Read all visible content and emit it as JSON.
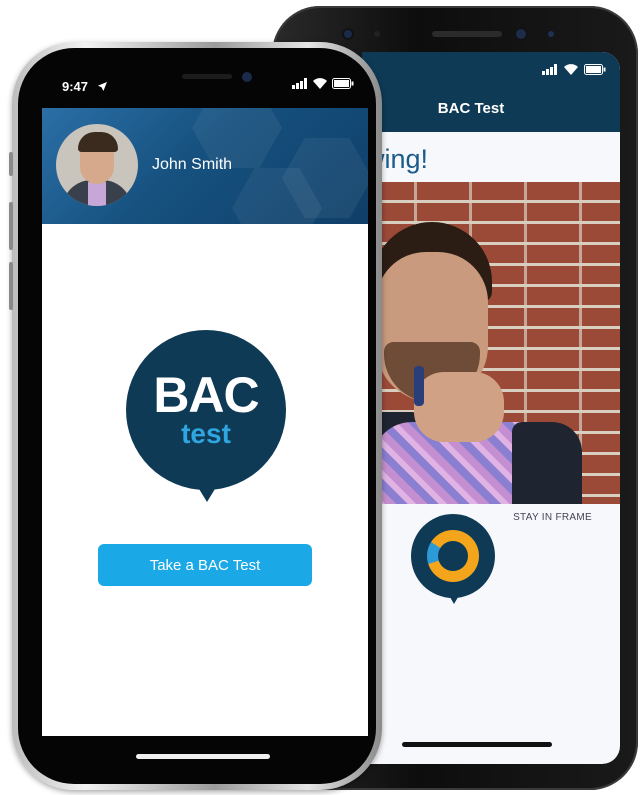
{
  "back_phone": {
    "status_icons": [
      "signal-icon",
      "wifi-icon",
      "battery-icon"
    ],
    "title": "BAC Test",
    "heading_partial": "owing!",
    "stay_in_frame": "STAY IN FRAME",
    "progress_ring": {
      "segments": [
        {
          "color": "#f4a51c"
        },
        {
          "color": "#2d9ad8"
        }
      ]
    }
  },
  "front_phone": {
    "status": {
      "time": "9:47",
      "icons": [
        "location-arrow-icon",
        "signal-icon",
        "wifi-icon",
        "battery-icon"
      ]
    },
    "profile": {
      "name": "John Smith"
    },
    "logo": {
      "line1": "BAC",
      "line2": "test"
    },
    "cta": {
      "label": "Take a BAC Test"
    }
  },
  "colors": {
    "brand_navy": "#0e3a56",
    "brand_blue": "#1aa8e6",
    "accent_orange": "#f4a51c"
  }
}
